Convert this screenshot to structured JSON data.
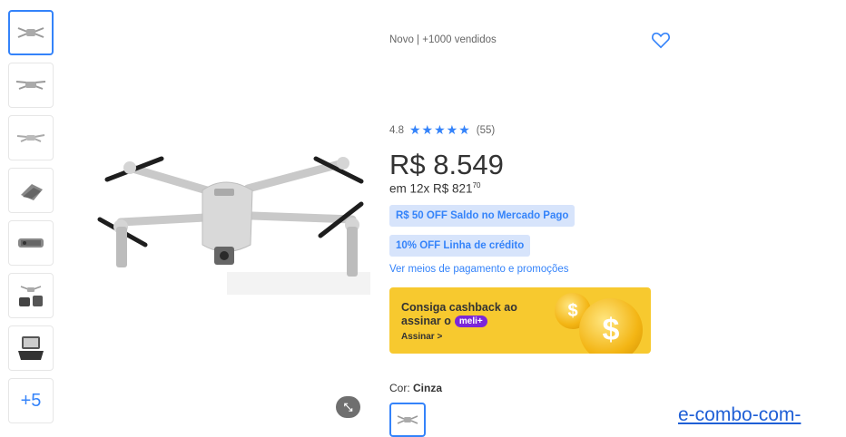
{
  "gallery": {
    "thumbnails": [
      {
        "icon": "drone-front-icon"
      },
      {
        "icon": "drone-side-icon"
      },
      {
        "icon": "drone-angle-icon"
      },
      {
        "icon": "drone-folded-icon"
      },
      {
        "icon": "drone-camera-icon"
      },
      {
        "icon": "drone-kit-icon"
      },
      {
        "icon": "remote-controller-icon"
      }
    ],
    "more_label": "+5",
    "zoom_hint": "⤡"
  },
  "product": {
    "subtitle": "Novo  |  +1000 vendidos",
    "rating_value": "4.8",
    "rating_stars": "★★★★★",
    "rating_count": "(55)",
    "price": "R$ 8.549",
    "installments_prefix": "em 12x R$ 821",
    "installments_cents": "70",
    "badge_balance": "R$ 50 OFF Saldo no Mercado Pago",
    "badge_credit": "10% OFF Linha de crédito",
    "payments_link": "Ver meios de pagamento e promoções"
  },
  "cashback": {
    "line1": "Consiga cashback ao",
    "line2_prefix": "assinar o",
    "meli_badge": "meli+",
    "cta": "Assinar  >"
  },
  "variant": {
    "label": "Cor:",
    "value": "Cinza"
  },
  "url_fragment": "e-combo-com-",
  "colors": {
    "accent": "#3483fa",
    "badge_bg": "#d7e4fb",
    "cashback_bg": "#f7c92f",
    "meli_purple": "#7b26d9"
  }
}
